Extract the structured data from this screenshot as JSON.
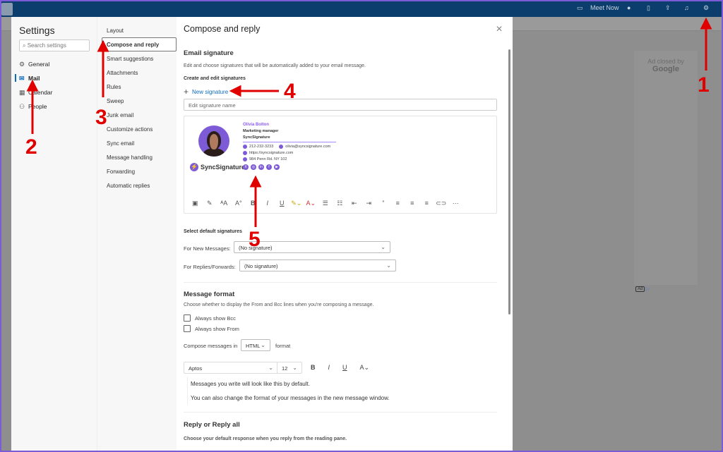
{
  "topbar": {
    "meet_now": "Meet Now",
    "icons": [
      "video-icon",
      "skype-icon",
      "office-icon",
      "share-icon",
      "bell-icon",
      "gear-icon"
    ]
  },
  "ad": {
    "closed": "Ad closed by",
    "brand": "Google",
    "badge": "Ad"
  },
  "settings": {
    "title": "Settings",
    "search_placeholder": "Search settings",
    "categories": [
      {
        "label": "General",
        "icon": "gear-icon"
      },
      {
        "label": "Mail",
        "icon": "mail-icon",
        "selected": true
      },
      {
        "label": "Calendar",
        "icon": "calendar-icon"
      },
      {
        "label": "People",
        "icon": "people-icon"
      }
    ],
    "mail_items": [
      "Layout",
      "Compose and reply",
      "Smart suggestions",
      "Attachments",
      "Rules",
      "Sweep",
      "Junk email",
      "Customize actions",
      "Sync email",
      "Message handling",
      "Forwarding",
      "Automatic replies"
    ],
    "selected_mail_item": "Compose and reply"
  },
  "page": {
    "title": "Compose and reply",
    "email_signature": {
      "heading": "Email signature",
      "description": "Edit and choose signatures that will be automatically added to your email message.",
      "create_label": "Create and edit signatures",
      "new_signature": "New signature",
      "name_placeholder": "Edit signature name"
    },
    "signature": {
      "name": "Olivia Bolton",
      "role": "Marketing manager",
      "company": "SyncSignature",
      "phone": "212-232-3233",
      "email": "olivia@syncsignature.com",
      "website": "https://syncsignature.com",
      "address": "984 Penn Rd. NY 102",
      "brand": "SyncSignature",
      "socials": [
        "x",
        "instagram",
        "linkedin",
        "facebook",
        "youtube"
      ],
      "accent": "#7e5bd6"
    },
    "defaults": {
      "heading": "Select default signatures",
      "new_label": "For New Messages:",
      "new_value": "(No signature)",
      "reply_label": "For Replies/Forwards:",
      "reply_value": "(No signature)"
    },
    "message_format": {
      "heading": "Message format",
      "description": "Choose whether to display the From and Bcc lines when you're composing a message.",
      "bcc": "Always show Bcc",
      "from": "Always show From",
      "compose_prefix": "Compose messages in",
      "format_value": "HTML",
      "compose_suffix": "format",
      "font": "Aptos",
      "size": "12",
      "preview1": "Messages you write will look like this by default.",
      "preview2": "You can also change the format of your messages in the new message window."
    },
    "reply": {
      "heading": "Reply or Reply all",
      "description": "Choose your default response when you reply from the reading pane."
    }
  },
  "annotations": [
    "1",
    "2",
    "3",
    "4",
    "5"
  ]
}
